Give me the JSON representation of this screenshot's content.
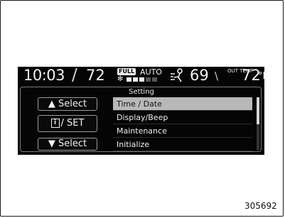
{
  "status_bar": {
    "clock": "10:03",
    "temp_left": "72",
    "fan_mode_badge": "FULL",
    "fan_mode_auto": "AUTO",
    "fan_level": 0.4,
    "temp_right": "69",
    "out_temp_label": "OUT TEMP",
    "out_temp_value": "72",
    "out_temp_unit": "°F"
  },
  "panel": {
    "title": "Setting",
    "buttons": {
      "up_label": "▲ Select",
      "info_label": "/ SET",
      "down_label": "▼ Select"
    },
    "items": [
      {
        "label": "Time / Date"
      },
      {
        "label": "Display/Beep"
      },
      {
        "label": "Maintenance"
      },
      {
        "label": "Initialize"
      }
    ]
  },
  "figure_ref": "305692",
  "icons": [
    "fan-icon",
    "airflow-icon",
    "info-icon"
  ],
  "colors": {
    "screen": "#050505",
    "selected_row": "#b8b8b8",
    "text": "#f0f0f0"
  }
}
